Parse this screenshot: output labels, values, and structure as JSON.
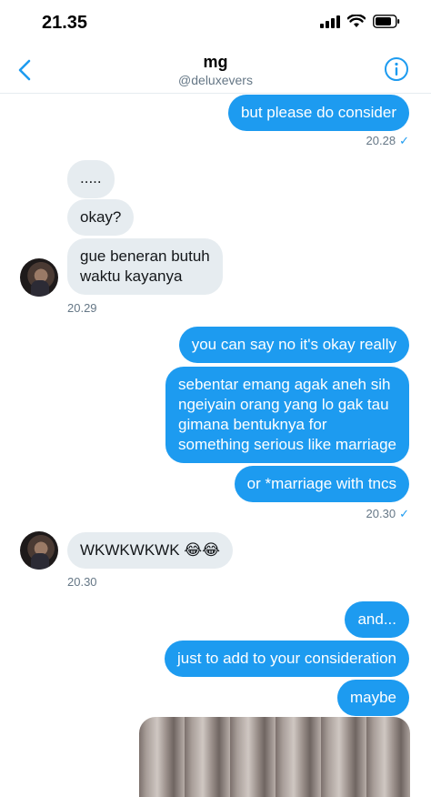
{
  "status": {
    "time": "21.35"
  },
  "header": {
    "name": "mg",
    "handle": "@deluxevers"
  },
  "icons": {
    "back": "chevron-left-icon",
    "info": "info-icon",
    "signal": "cellular-signal-icon",
    "wifi": "wifi-icon",
    "battery": "battery-icon"
  },
  "colors": {
    "accent": "#1d9bf0",
    "incoming": "#e6ecf0",
    "muted": "#657786"
  },
  "messages": [
    {
      "dir": "out",
      "text": "but please do consider"
    },
    {
      "dir": "ts",
      "text": "20.28"
    },
    {
      "dir": "in",
      "text": "....."
    },
    {
      "dir": "in",
      "text": "okay?"
    },
    {
      "dir": "in",
      "text": "gue beneran butuh\nwaktu kayanya"
    },
    {
      "dir": "ts",
      "text": "20.29"
    },
    {
      "dir": "out",
      "text": "you can say no it's okay really"
    },
    {
      "dir": "out",
      "text": "sebentar emang agak aneh sih\nngeiyain orang yang lo gak tau\ngimana bentuknya for\nsomething serious like marriage"
    },
    {
      "dir": "out",
      "text": "or *marriage with tncs"
    },
    {
      "dir": "ts",
      "text": "20.30"
    },
    {
      "dir": "in",
      "text": "WKWKWKWK 😂😂"
    },
    {
      "dir": "ts",
      "text": "20.30"
    },
    {
      "dir": "out",
      "text": "and..."
    },
    {
      "dir": "out",
      "text": "just to add to your consideration"
    },
    {
      "dir": "out",
      "text": "maybe"
    }
  ]
}
